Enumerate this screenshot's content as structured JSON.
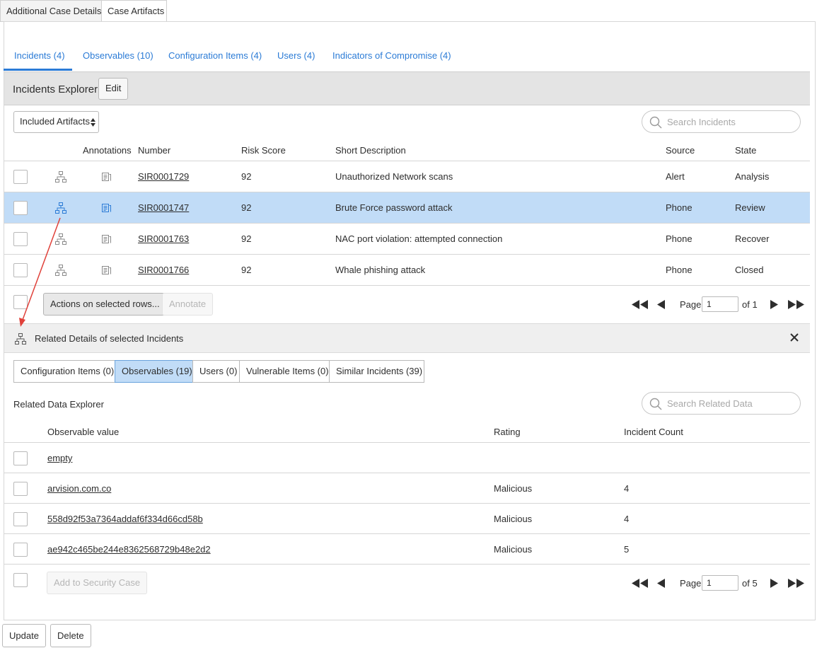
{
  "top_tabs": [
    {
      "label": "Additional Case Details",
      "active": false
    },
    {
      "label": "Case Artifacts",
      "active": true
    }
  ],
  "artifact_tabs": [
    {
      "label": "Incidents (4)",
      "active": true
    },
    {
      "label": "Observables (10)"
    },
    {
      "label": "Configuration Items (4)"
    },
    {
      "label": "Users (4)"
    },
    {
      "label": "Indicators of Compromise (4)"
    }
  ],
  "incidents_explorer": {
    "title": "Incidents Explorer",
    "edit_label": "Edit",
    "filter_select": "Included Artifacts",
    "search_placeholder": "Search Incidents",
    "columns": [
      "Annotations",
      "Number",
      "Risk Score",
      "Short Description",
      "Source",
      "State"
    ],
    "rows": [
      {
        "number": "SIR0001729",
        "risk": "92",
        "desc": "Unauthorized Network scans",
        "source": "Alert",
        "state": "Analysis",
        "selected": false
      },
      {
        "number": "SIR0001747",
        "risk": "92",
        "desc": "Brute Force password attack",
        "source": "Phone",
        "state": "Review",
        "selected": true
      },
      {
        "number": "SIR0001763",
        "risk": "92",
        "desc": "NAC port violation: attempted connection",
        "source": "Phone",
        "state": "Recover",
        "selected": false
      },
      {
        "number": "SIR0001766",
        "risk": "92",
        "desc": "Whale phishing attack",
        "source": "Phone",
        "state": "Closed",
        "selected": false
      }
    ],
    "actions_label": "Actions on selected rows...",
    "annotate_label": "Annotate",
    "pager": {
      "page_label": "Page",
      "page": "1",
      "of": "of 1"
    }
  },
  "related": {
    "title": "Related Details of selected Incidents",
    "tabs": [
      {
        "label": "Configuration Items (0)"
      },
      {
        "label": "Observables (19)",
        "active": true
      },
      {
        "label": "Users (0)"
      },
      {
        "label": "Vulnerable Items (0)"
      },
      {
        "label": "Similar Incidents (39)"
      }
    ],
    "explorer_label": "Related Data Explorer",
    "search_placeholder": "Search Related Data",
    "columns": [
      "Observable value",
      "Rating",
      "Incident Count"
    ],
    "rows": [
      {
        "value": "empty",
        "rating": "",
        "count": ""
      },
      {
        "value": "arvision.com.co",
        "rating": "Malicious",
        "count": "4"
      },
      {
        "value": "558d92f53a7364addaf6f334d66cd58b",
        "rating": "Malicious",
        "count": "4"
      },
      {
        "value": "ae942c465be244e8362568729b48e2d2",
        "rating": "Malicious",
        "count": "5"
      }
    ],
    "add_label": "Add to Security Case",
    "pager": {
      "page_label": "Page",
      "page": "1",
      "of": "of 5"
    }
  },
  "footer": {
    "update_label": "Update",
    "delete_label": "Delete"
  },
  "colors": {
    "accent": "#2b7bd6",
    "selected_row": "#c1dcf7",
    "annotation_arrow": "#e0413a"
  },
  "icons": [
    "hierarchy-icon",
    "annotation-icon",
    "search-icon",
    "first-page-icon",
    "prev-page-icon",
    "next-page-icon",
    "last-page-icon",
    "close-icon",
    "sort-icon"
  ]
}
